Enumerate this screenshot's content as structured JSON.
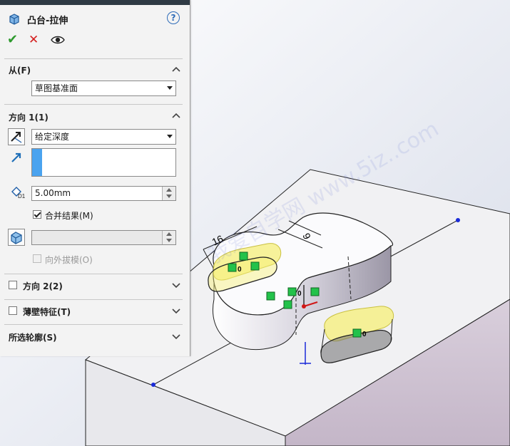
{
  "feature": {
    "title": "凸台-拉伸",
    "help_glyph": "?"
  },
  "actions": {
    "ok_glyph": "✔",
    "cancel_glyph": "✕"
  },
  "from_section": {
    "title": "从(F)",
    "selected": "草图基准面"
  },
  "direction1": {
    "title": "方向 1(1)",
    "end_condition": "给定深度",
    "depth": "5.00mm",
    "merge_result_label": "合并结果(M)",
    "merge_result_checked": true,
    "draft_value": "",
    "draft_outward_label": "向外拔模(O)"
  },
  "direction2": {
    "title": "方向 2(2)",
    "checked": false
  },
  "thin_feature": {
    "title": "薄壁特征(T)",
    "checked": false
  },
  "selected_contours": {
    "title": "所选轮廓(S)"
  },
  "viewport": {
    "dimension_16": "16",
    "dimension_9": "9",
    "dim_label": "D1",
    "constraint_zero": "0",
    "watermark": "我爱自学网 www.5iz..com"
  },
  "colors": {
    "accent_blue": "#4aa3ef",
    "ok_green": "#2e9a2e",
    "cancel_red": "#d42020",
    "highlight_yellow": "#f6ef78",
    "plate_top": "#f2f2f4",
    "plate_side": "#cbbccf"
  }
}
